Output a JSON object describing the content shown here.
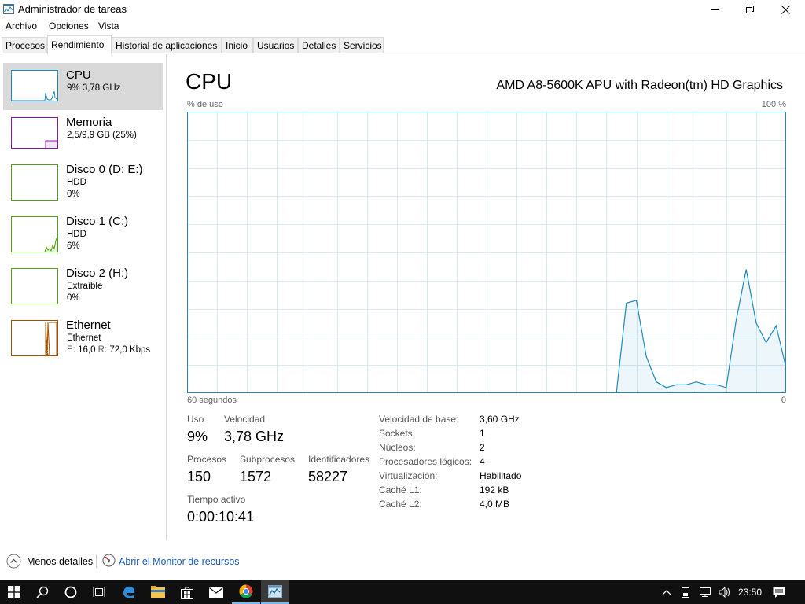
{
  "window": {
    "title": "Administrador de tareas"
  },
  "menu": {
    "items": [
      "Archivo",
      "Opciones",
      "Vista"
    ]
  },
  "tabs": [
    {
      "label": "Procesos"
    },
    {
      "label": "Rendimiento",
      "active": true
    },
    {
      "label": "Historial de aplicaciones"
    },
    {
      "label": "Inicio"
    },
    {
      "label": "Usuarios"
    },
    {
      "label": "Detalles"
    },
    {
      "label": "Servicios"
    }
  ],
  "sidebar": {
    "items": [
      {
        "name": "CPU",
        "line1": "9% 3,78 GHz",
        "selected": true,
        "color": "#1b8ac0"
      },
      {
        "name": "Memoria",
        "line1": "2,5/9,9 GB (25%)",
        "color": "#8b12ae"
      },
      {
        "name": "Disco 0 (D: E:)",
        "line1": "HDD",
        "line2": "0%",
        "color": "#4da60c"
      },
      {
        "name": "Disco 1 (C:)",
        "line1": "HDD",
        "line2": "6%",
        "color": "#4da60c"
      },
      {
        "name": "Disco 2 (H:)",
        "line1": "Extraíble",
        "line2": "0%",
        "color": "#4da60c"
      },
      {
        "name": "Ethernet",
        "line1": "Ethernet",
        "e_label": "E:",
        "e_value": "16,0",
        "r_label": "R:",
        "r_value": "72,0 Kbps",
        "color": "#a74f01"
      }
    ]
  },
  "cpu": {
    "title": "CPU",
    "processor": "AMD A8-5600K APU with Radeon(tm) HD Graphics",
    "y_label": "% de uso",
    "y_max_label": "100 %",
    "x_label": "60 segundos",
    "x_min_label": "0",
    "accent_color": "#1b8ac0",
    "grid_color": "#d9eaf4"
  },
  "chart_data": {
    "type": "area",
    "title": "",
    "xlabel": "60 segundos",
    "ylabel": "% de uso",
    "ylim": [
      0,
      100
    ],
    "xlim": [
      60,
      0
    ],
    "x": [
      60,
      59,
      58,
      57,
      56,
      55,
      54,
      53,
      52,
      51,
      50,
      49,
      48,
      47,
      46,
      45,
      44,
      43,
      42,
      41,
      40,
      39,
      38,
      37,
      36,
      35,
      34,
      33,
      33,
      17,
      16,
      15,
      14,
      13,
      12,
      11,
      10,
      9,
      8,
      7,
      6,
      5,
      4,
      3,
      2,
      1,
      0
    ],
    "values": [
      0,
      0,
      0,
      0,
      0,
      0,
      0,
      0,
      0,
      0,
      0,
      0,
      0,
      0,
      0,
      0,
      0,
      0,
      0,
      0,
      0,
      0,
      0,
      0,
      0,
      0,
      0,
      0,
      0,
      0,
      32,
      33,
      13,
      4,
      2,
      3,
      3,
      4,
      3,
      3,
      2,
      26,
      44,
      25,
      18,
      24,
      9
    ],
    "grid": true
  },
  "stats": {
    "uso": {
      "label": "Uso",
      "value": "9%"
    },
    "velocidad": {
      "label": "Velocidad",
      "value": "3,78 GHz"
    },
    "procesos": {
      "label": "Procesos",
      "value": "150"
    },
    "subprocesos": {
      "label": "Subprocesos",
      "value": "1572"
    },
    "identificadores": {
      "label": "Identificadores",
      "value": "58227"
    },
    "tiempo": {
      "label": "Tiempo activo",
      "value": "0:00:10:41"
    }
  },
  "specs": [
    {
      "label": "Velocidad de base:",
      "value": "3,60 GHz"
    },
    {
      "label": "Sockets:",
      "value": "1"
    },
    {
      "label": "Núcleos:",
      "value": "2"
    },
    {
      "label": "Procesadores lógicos:",
      "value": "4"
    },
    {
      "label": "Virtualización:",
      "value": "Habilitado"
    },
    {
      "label": "Caché L1:",
      "value": "192 kB"
    },
    {
      "label": "Caché L2:",
      "value": "4,0 MB"
    }
  ],
  "footer": {
    "less_details": "Menos detalles",
    "resource_monitor": "Abrir el Monitor de recursos"
  },
  "taskbar": {
    "clock": "23:50",
    "icons": [
      "windows-start-icon",
      "search-icon",
      "cortana-icon",
      "task-view-icon",
      "edge-icon",
      "file-explorer-icon",
      "store-icon",
      "mail-icon",
      "chrome-icon",
      "task-manager-icon"
    ]
  }
}
